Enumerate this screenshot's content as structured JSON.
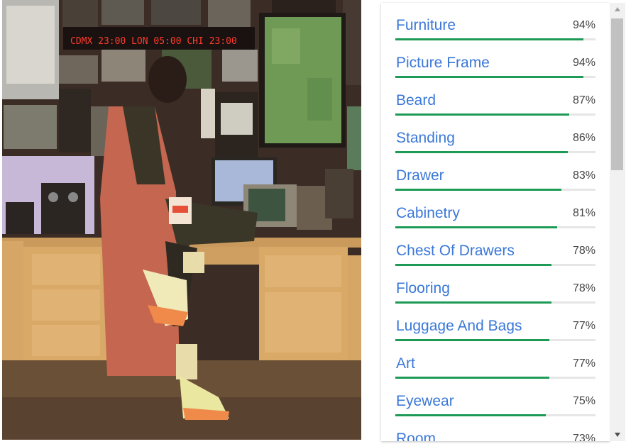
{
  "photo": {
    "clock": "CDMX 23:00   LON 05:00   CHI 23:00"
  },
  "labels": [
    {
      "name": "Furniture",
      "score": "94%",
      "value": 0.94
    },
    {
      "name": "Picture Frame",
      "score": "94%",
      "value": 0.94
    },
    {
      "name": "Beard",
      "score": "87%",
      "value": 0.87
    },
    {
      "name": "Standing",
      "score": "86%",
      "value": 0.86
    },
    {
      "name": "Drawer",
      "score": "83%",
      "value": 0.83
    },
    {
      "name": "Cabinetry",
      "score": "81%",
      "value": 0.81
    },
    {
      "name": "Chest Of Drawers",
      "score": "78%",
      "value": 0.78
    },
    {
      "name": "Flooring",
      "score": "78%",
      "value": 0.78
    },
    {
      "name": "Luggage And Bags",
      "score": "77%",
      "value": 0.77
    },
    {
      "name": "Art",
      "score": "77%",
      "value": 0.77
    },
    {
      "name": "Eyewear",
      "score": "75%",
      "value": 0.75
    },
    {
      "name": "Room",
      "score": "73%",
      "value": 0.73
    }
  ],
  "colors": {
    "label_text": "#3b78d8",
    "bar_fill": "#1d9a55",
    "bar_track": "#e6e6e6"
  },
  "scrollbar": {
    "up_icon": "triangle-up-icon",
    "down_icon": "triangle-down-icon"
  }
}
